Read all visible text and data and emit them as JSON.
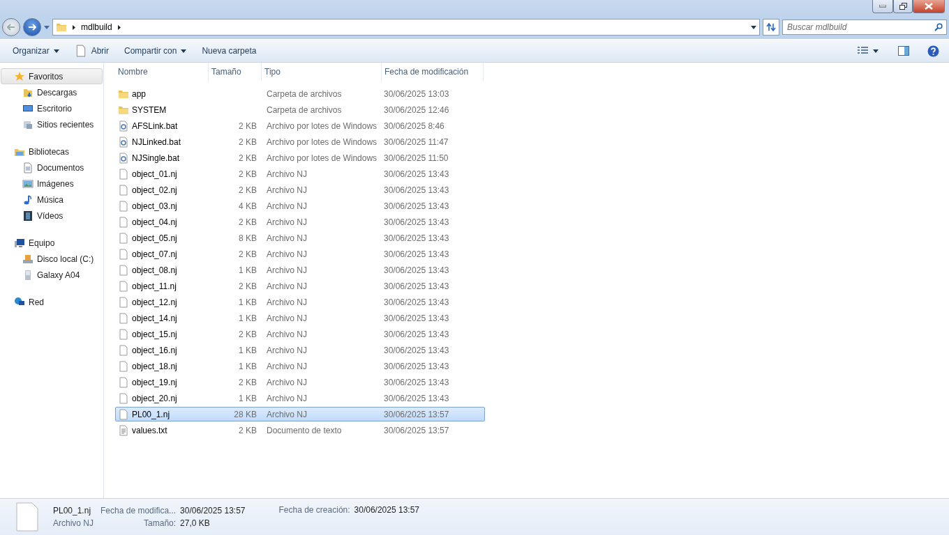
{
  "address_bar": {
    "crumbs": [
      "mdlbuild"
    ],
    "search_placeholder": "Buscar mdlbuild"
  },
  "toolbar": {
    "items": [
      {
        "label": "Organizar",
        "kind": "menu"
      },
      {
        "label": "Abrir",
        "kind": "open"
      },
      {
        "label": "Compartir con",
        "kind": "menu"
      },
      {
        "label": "Nueva carpeta",
        "kind": "plain"
      }
    ]
  },
  "sidebar": {
    "groups": [
      {
        "label": "Favoritos",
        "selected": true,
        "children": [
          {
            "label": "Descargas"
          },
          {
            "label": "Escritorio"
          },
          {
            "label": "Sitios recientes"
          }
        ]
      },
      {
        "label": "Bibliotecas",
        "selected": false,
        "children": [
          {
            "label": "Documentos"
          },
          {
            "label": "Imágenes"
          },
          {
            "label": "Música"
          },
          {
            "label": "Vídeos"
          }
        ]
      },
      {
        "label": "Equipo",
        "selected": false,
        "children": [
          {
            "label": "Disco local (C:)"
          },
          {
            "label": "Galaxy A04"
          }
        ]
      },
      {
        "label": "Red",
        "selected": false
      }
    ]
  },
  "table": {
    "columns": [
      "Nombre",
      "Tamaño",
      "Tipo",
      "Fecha de modificación"
    ],
    "rows": [
      {
        "kind": "folder",
        "name": "app",
        "size": "",
        "type": "Carpeta de archivos",
        "modified": "30/06/2025 13:03",
        "selected": false
      },
      {
        "kind": "folder",
        "name": "SYSTEM",
        "size": "",
        "type": "Carpeta de archivos",
        "modified": "30/06/2025 12:46",
        "selected": false
      },
      {
        "kind": "bat",
        "name": "AFSLink.bat",
        "size": "2 KB",
        "type": "Archivo por lotes de Windows",
        "modified": "30/06/2025 8:46",
        "selected": false
      },
      {
        "kind": "bat",
        "name": "NJLinked.bat",
        "size": "2 KB",
        "type": "Archivo por lotes de Windows",
        "modified": "30/06/2025 11:47",
        "selected": false
      },
      {
        "kind": "bat",
        "name": "NJSingle.bat",
        "size": "2 KB",
        "type": "Archivo por lotes de Windows",
        "modified": "30/06/2025 11:50",
        "selected": false
      },
      {
        "kind": "file",
        "name": "object_01.nj",
        "size": "2 KB",
        "type": "Archivo NJ",
        "modified": "30/06/2025 13:43",
        "selected": false
      },
      {
        "kind": "file",
        "name": "object_02.nj",
        "size": "2 KB",
        "type": "Archivo NJ",
        "modified": "30/06/2025 13:43",
        "selected": false
      },
      {
        "kind": "file",
        "name": "object_03.nj",
        "size": "4 KB",
        "type": "Archivo NJ",
        "modified": "30/06/2025 13:43",
        "selected": false
      },
      {
        "kind": "file",
        "name": "object_04.nj",
        "size": "2 KB",
        "type": "Archivo NJ",
        "modified": "30/06/2025 13:43",
        "selected": false
      },
      {
        "kind": "file",
        "name": "object_05.nj",
        "size": "8 KB",
        "type": "Archivo NJ",
        "modified": "30/06/2025 13:43",
        "selected": false
      },
      {
        "kind": "file",
        "name": "object_07.nj",
        "size": "2 KB",
        "type": "Archivo NJ",
        "modified": "30/06/2025 13:43",
        "selected": false
      },
      {
        "kind": "file",
        "name": "object_08.nj",
        "size": "1 KB",
        "type": "Archivo NJ",
        "modified": "30/06/2025 13:43",
        "selected": false
      },
      {
        "kind": "file",
        "name": "object_11.nj",
        "size": "2 KB",
        "type": "Archivo NJ",
        "modified": "30/06/2025 13:43",
        "selected": false
      },
      {
        "kind": "file",
        "name": "object_12.nj",
        "size": "1 KB",
        "type": "Archivo NJ",
        "modified": "30/06/2025 13:43",
        "selected": false
      },
      {
        "kind": "file",
        "name": "object_14.nj",
        "size": "1 KB",
        "type": "Archivo NJ",
        "modified": "30/06/2025 13:43",
        "selected": false
      },
      {
        "kind": "file",
        "name": "object_15.nj",
        "size": "2 KB",
        "type": "Archivo NJ",
        "modified": "30/06/2025 13:43",
        "selected": false
      },
      {
        "kind": "file",
        "name": "object_16.nj",
        "size": "1 KB",
        "type": "Archivo NJ",
        "modified": "30/06/2025 13:43",
        "selected": false
      },
      {
        "kind": "file",
        "name": "object_18.nj",
        "size": "1 KB",
        "type": "Archivo NJ",
        "modified": "30/06/2025 13:43",
        "selected": false
      },
      {
        "kind": "file",
        "name": "object_19.nj",
        "size": "2 KB",
        "type": "Archivo NJ",
        "modified": "30/06/2025 13:43",
        "selected": false
      },
      {
        "kind": "file",
        "name": "object_20.nj",
        "size": "1 KB",
        "type": "Archivo NJ",
        "modified": "30/06/2025 13:43",
        "selected": false
      },
      {
        "kind": "file",
        "name": "PL00_1.nj",
        "size": "28 KB",
        "type": "Archivo NJ",
        "modified": "30/06/2025 13:57",
        "selected": true
      },
      {
        "kind": "text",
        "name": "values.txt",
        "size": "2 KB",
        "type": "Documento de texto",
        "modified": "30/06/2025 13:57",
        "selected": false
      }
    ]
  },
  "details": {
    "name": "PL00_1.nj",
    "type": "Archivo NJ",
    "fields": [
      {
        "label": "Fecha de modifica...",
        "value": "30/06/2025 13:57"
      },
      {
        "label": "Tamaño:",
        "value": "27,0 KB"
      },
      {
        "label": "Fecha de creación:",
        "value": "30/06/2025 13:57"
      }
    ]
  }
}
